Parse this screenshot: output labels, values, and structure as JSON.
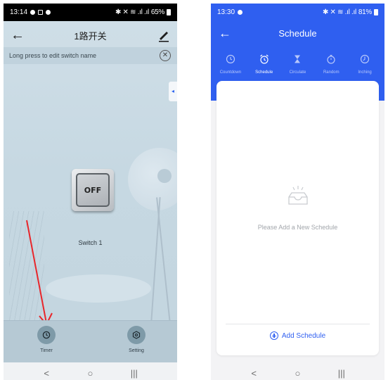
{
  "left_screen": {
    "status_bar": {
      "time": "13:14",
      "battery": "65%"
    },
    "header": {
      "title": "1路开关",
      "back_icon": "arrow-left-icon",
      "edit_icon": "pencil-icon"
    },
    "notice": {
      "text": "Long press to edit switch name",
      "close_icon": "close-circle-icon"
    },
    "switch": {
      "state_label": "OFF",
      "name": "Switch 1"
    },
    "annotation": {
      "arrow_color": "#e8262b"
    },
    "bottom_bar": {
      "timer_label": "Timer",
      "setting_label": "Setting"
    },
    "nav": {
      "back": "<",
      "home": "○",
      "recents": "|||"
    }
  },
  "right_screen": {
    "status_bar": {
      "time": "13:30",
      "battery": "81%"
    },
    "header": {
      "title": "Schedule",
      "back_icon": "arrow-left-icon"
    },
    "tabs": [
      {
        "label": "Countdown",
        "icon": "clock-icon",
        "active": false
      },
      {
        "label": "Schedule",
        "icon": "alarm-clock-icon",
        "active": true
      },
      {
        "label": "Circulate",
        "icon": "hourglass-icon",
        "active": false
      },
      {
        "label": "Random",
        "icon": "stopwatch-icon",
        "active": false
      },
      {
        "label": "Inching",
        "icon": "timer-icon",
        "active": false
      }
    ],
    "empty_state": {
      "text": "Please Add a New Schedule",
      "icon": "empty-inbox-icon"
    },
    "add_button": {
      "label": "Add Schedule"
    },
    "nav": {
      "back": "<",
      "home": "○",
      "recents": "|||"
    }
  },
  "colors": {
    "accent": "#2f5ff0",
    "left_background": "#c6d8e2"
  }
}
